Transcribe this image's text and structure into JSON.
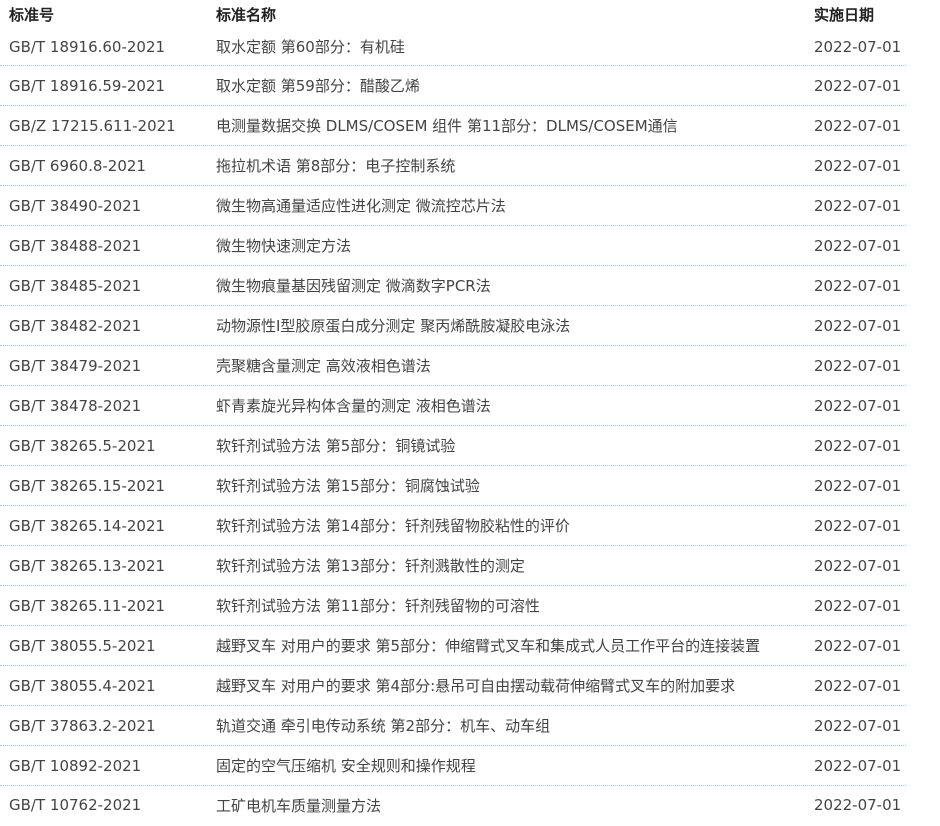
{
  "table": {
    "headers": {
      "code": "标准号",
      "name": "标准名称",
      "date": "实施日期"
    },
    "rows": [
      {
        "code": "GB/T 18916.60-2021",
        "name": "取水定额 第60部分：有机硅",
        "date": "2022-07-01"
      },
      {
        "code": "GB/T 18916.59-2021",
        "name": "取水定额 第59部分：醋酸乙烯",
        "date": "2022-07-01"
      },
      {
        "code": "GB/Z 17215.611-2021",
        "name": "电测量数据交换 DLMS/COSEM 组件 第11部分：DLMS/COSEM通信",
        "date": "2022-07-01"
      },
      {
        "code": "GB/T 6960.8-2021",
        "name": "拖拉机术语 第8部分：电子控制系统",
        "date": "2022-07-01"
      },
      {
        "code": "GB/T 38490-2021",
        "name": "微生物高通量适应性进化测定 微流控芯片法",
        "date": "2022-07-01"
      },
      {
        "code": "GB/T 38488-2021",
        "name": "微生物快速测定方法",
        "date": "2022-07-01"
      },
      {
        "code": "GB/T 38485-2021",
        "name": "微生物痕量基因残留测定 微滴数字PCR法",
        "date": "2022-07-01"
      },
      {
        "code": "GB/T 38482-2021",
        "name": "动物源性I型胶原蛋白成分测定 聚丙烯酰胺凝胶电泳法",
        "date": "2022-07-01"
      },
      {
        "code": "GB/T 38479-2021",
        "name": "壳聚糖含量测定 高效液相色谱法",
        "date": "2022-07-01"
      },
      {
        "code": "GB/T 38478-2021",
        "name": "虾青素旋光异构体含量的测定 液相色谱法",
        "date": "2022-07-01"
      },
      {
        "code": "GB/T 38265.5-2021",
        "name": "软钎剂试验方法 第5部分：铜镜试验",
        "date": "2022-07-01"
      },
      {
        "code": "GB/T 38265.15-2021",
        "name": "软钎剂试验方法 第15部分：铜腐蚀试验",
        "date": "2022-07-01"
      },
      {
        "code": "GB/T 38265.14-2021",
        "name": "软钎剂试验方法 第14部分：钎剂残留物胶粘性的评价",
        "date": "2022-07-01"
      },
      {
        "code": "GB/T 38265.13-2021",
        "name": "软钎剂试验方法 第13部分：钎剂溅散性的测定",
        "date": "2022-07-01"
      },
      {
        "code": "GB/T 38265.11-2021",
        "name": "软钎剂试验方法 第11部分：钎剂残留物的可溶性",
        "date": "2022-07-01"
      },
      {
        "code": "GB/T 38055.5-2021",
        "name": "越野叉车 对用户的要求 第5部分：伸缩臂式叉车和集成式人员工作平台的连接装置",
        "date": "2022-07-01"
      },
      {
        "code": "GB/T 38055.4-2021",
        "name": "越野叉车 对用户的要求 第4部分:悬吊可自由摆动载荷伸缩臂式叉车的附加要求",
        "date": "2022-07-01"
      },
      {
        "code": "GB/T 37863.2-2021",
        "name": "轨道交通 牵引电传动系统 第2部分：机车、动车组",
        "date": "2022-07-01"
      },
      {
        "code": "GB/T 10892-2021",
        "name": "固定的空气压缩机 安全规则和操作规程",
        "date": "2022-07-01"
      },
      {
        "code": "GB/T 10762-2021",
        "name": "工矿电机车质量测量方法",
        "date": "2022-07-01"
      }
    ]
  }
}
